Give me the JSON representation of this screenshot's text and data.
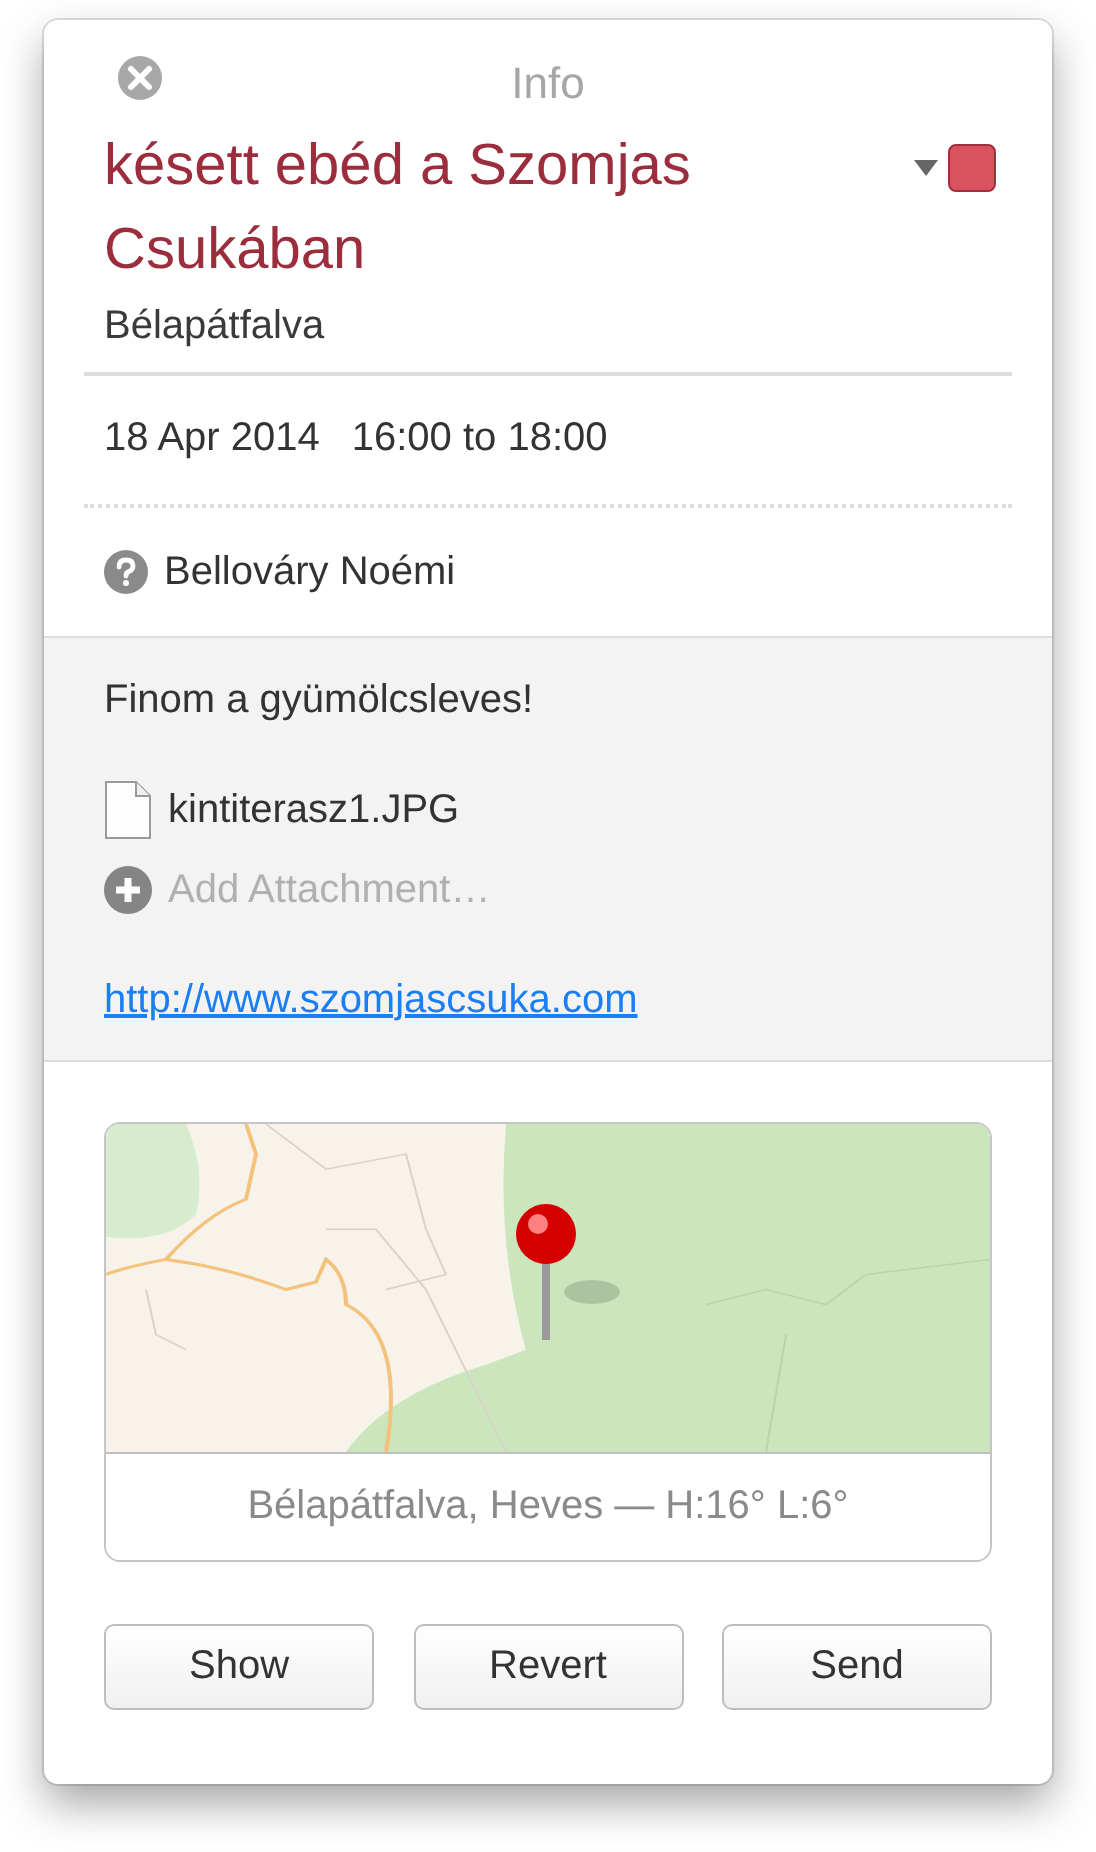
{
  "window": {
    "title": "Info"
  },
  "event": {
    "title": "késett ebéd a Szomjas Csukában",
    "location": "Bélapátfalva",
    "date": "18 Apr 2014",
    "time": "16:00 to 18:00"
  },
  "calendar": {
    "color": "#d9525f"
  },
  "attendees": [
    {
      "name": "Bellováry Noémi",
      "pending": true
    }
  ],
  "notes": "Finom a gyümölcsleves!",
  "attachments": [
    {
      "name": "kintiterasz1.JPG"
    }
  ],
  "add_attachment": {
    "label": "Add Attachment…",
    "disabled": true
  },
  "url": "http://www.szomjascsuka.com",
  "map": {
    "caption": "Bélapátfalva, Heves — H:16° L:6°"
  },
  "buttons": [
    {
      "label": "Show"
    },
    {
      "label": "Revert"
    },
    {
      "label": "Send"
    }
  ]
}
